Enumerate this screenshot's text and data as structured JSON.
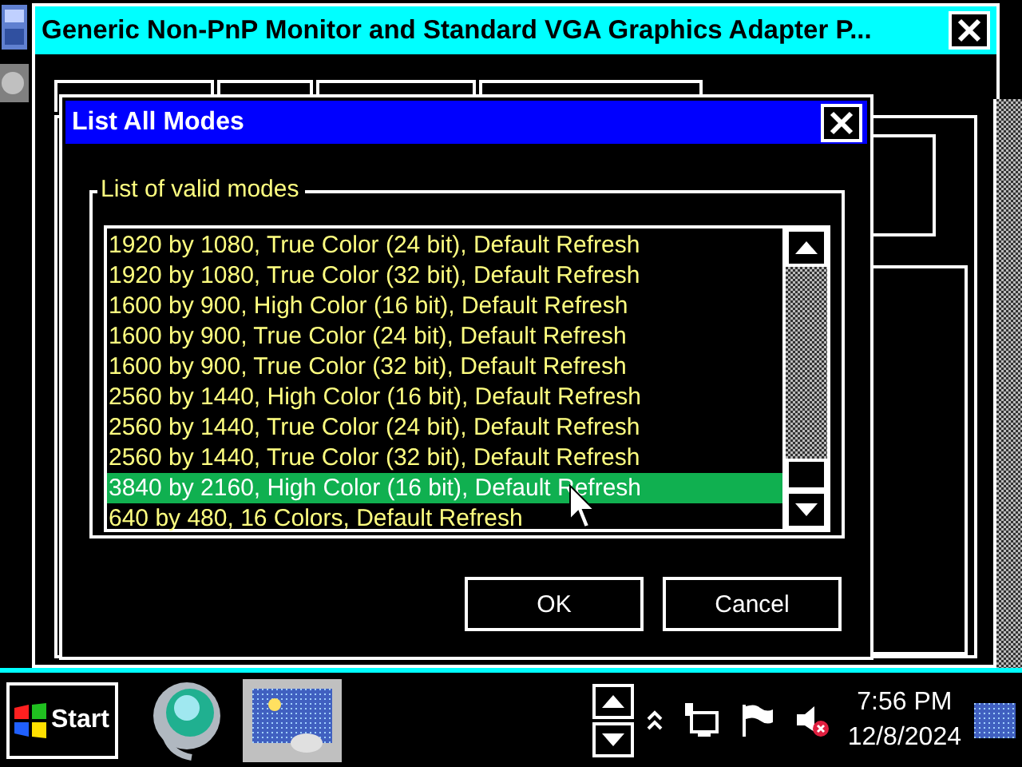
{
  "background_window": {
    "title": "Generic Non-PnP Monitor and Standard VGA Graphics Adapter P..."
  },
  "dialog": {
    "title": "List All Modes",
    "group_label": "List of valid modes",
    "modes": [
      {
        "label": "1920 by 1080, True Color (24 bit), Default Refresh",
        "selected": false
      },
      {
        "label": "1920 by 1080, True Color (32 bit), Default Refresh",
        "selected": false
      },
      {
        "label": "1600 by 900, High Color (16 bit), Default Refresh",
        "selected": false
      },
      {
        "label": "1600 by 900, True Color (24 bit), Default Refresh",
        "selected": false
      },
      {
        "label": "1600 by 900, True Color (32 bit), Default Refresh",
        "selected": false
      },
      {
        "label": "2560 by 1440, High Color (16 bit), Default Refresh",
        "selected": false
      },
      {
        "label": "2560 by 1440, True Color (24 bit), Default Refresh",
        "selected": false
      },
      {
        "label": "2560 by 1440, True Color (32 bit), Default Refresh",
        "selected": false
      },
      {
        "label": "3840 by 2160, High Color (16 bit), Default Refresh",
        "selected": true
      },
      {
        "label": "640 by 480, 16 Colors, Default Refresh",
        "selected": false
      }
    ],
    "buttons": [
      "OK",
      "Cancel"
    ]
  },
  "taskbar": {
    "start_label": "Start",
    "time": "7:56 PM",
    "date": "12/8/2024"
  }
}
